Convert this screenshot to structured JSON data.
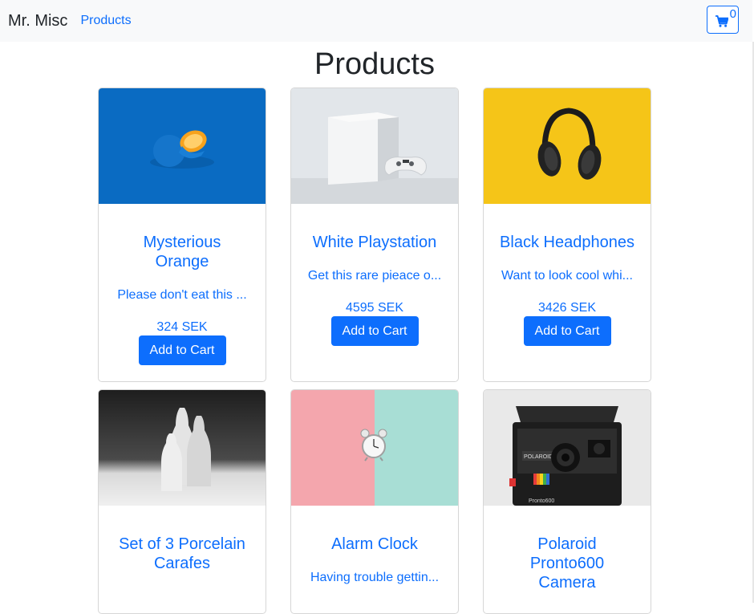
{
  "navbar": {
    "brand": "Mr. Misc",
    "products_link": "Products",
    "cart_count": "0",
    "cart_icon": "shopping-cart-icon"
  },
  "page": {
    "title": "Products"
  },
  "colors": {
    "accent": "#0d6efd",
    "navbar_bg": "#f8f9fa"
  },
  "products": [
    {
      "name": "Mysterious Orange",
      "description": "Please don't eat this ...",
      "price": "324 SEK",
      "button": "Add to Cart",
      "image": "orange-on-blue-photo"
    },
    {
      "name": "White Playstation",
      "description": "Get this rare pieace o...",
      "price": "4595 SEK",
      "button": "Add to Cart",
      "image": "white-console-photo"
    },
    {
      "name": "Black Headphones",
      "description": "Want to look cool whi...",
      "price": "3426 SEK",
      "button": "Add to Cart",
      "image": "headphones-on-yellow-photo"
    },
    {
      "name": "Set of 3 Porcelain Carafes",
      "description": "",
      "price": "",
      "button": "",
      "image": "porcelain-carafes-photo"
    },
    {
      "name": "Alarm Clock",
      "description": "Having trouble gettin...",
      "price": "",
      "button": "",
      "image": "alarm-clock-photo"
    },
    {
      "name": "Polaroid Pronto600 Camera",
      "description": "",
      "price": "",
      "button": "",
      "image": "polaroid-camera-photo"
    }
  ],
  "image_text": {
    "polaroid_brand": "POLAROID",
    "polaroid_model": "Pronto600"
  }
}
